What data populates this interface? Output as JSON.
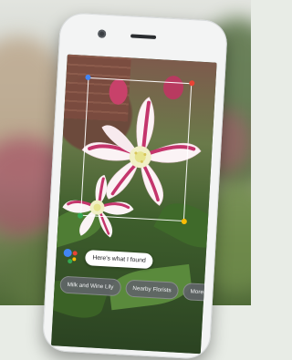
{
  "assistant": {
    "response_text": "Here's what I found"
  },
  "suggestions": [
    {
      "label": "Milk and Wine Lily"
    },
    {
      "label": "Nearby Florists"
    },
    {
      "label": "More I"
    }
  ],
  "colors": {
    "google_blue": "#4285f4",
    "google_red": "#ea4335",
    "google_yellow": "#fbbc05",
    "google_green": "#34a853"
  },
  "icons": [
    "camera-icon",
    "google-assistant-icon"
  ]
}
